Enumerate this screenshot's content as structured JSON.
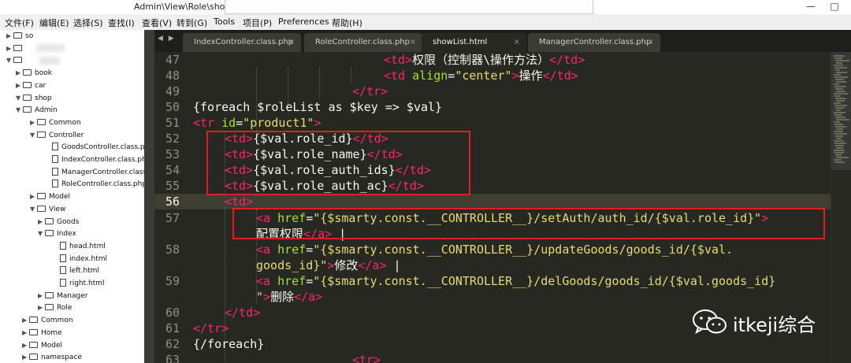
{
  "window": {
    "title_path": "Admin\\View\\Role\\showList.html",
    "title_suffix": "•",
    "controls": {
      "minimize": "—",
      "maximize": "□"
    }
  },
  "menu": [
    "文件(F)",
    "编辑(E)",
    "选择(S)",
    "查找(I)",
    "查看(V)",
    "转到(G)",
    "Tools",
    "项目(P)",
    "Preferences",
    "帮助(H)"
  ],
  "sidebar": {
    "items": [
      {
        "label": "so",
        "type": "folder",
        "state": "collapsed",
        "depth": 0
      },
      {
        "label": "",
        "type": "folder",
        "state": "collapsed",
        "depth": 0
      },
      {
        "label": "",
        "type": "folder",
        "state": "expanded",
        "depth": 0
      },
      {
        "label": "book",
        "type": "folder",
        "state": "collapsed",
        "depth": 1
      },
      {
        "label": "car",
        "type": "folder",
        "state": "collapsed",
        "depth": 1
      },
      {
        "label": "shop",
        "type": "folder",
        "state": "expanded",
        "depth": 1
      },
      {
        "label": "Admin",
        "type": "folder",
        "state": "expanded",
        "depth": 2
      },
      {
        "label": "Common",
        "type": "folder",
        "state": "collapsed",
        "depth": 3
      },
      {
        "label": "Controller",
        "type": "folder",
        "state": "expanded",
        "depth": 3
      },
      {
        "label": "GoodsController.class.ph",
        "type": "file",
        "depth": 4
      },
      {
        "label": "IndexController.class.ph",
        "type": "file",
        "depth": 4
      },
      {
        "label": "ManagerController.class",
        "type": "file",
        "depth": 4
      },
      {
        "label": "RoleController.class.php",
        "type": "file",
        "depth": 4
      },
      {
        "label": "Model",
        "type": "folder",
        "state": "collapsed",
        "depth": 3
      },
      {
        "label": "View",
        "type": "folder",
        "state": "expanded",
        "depth": 3
      },
      {
        "label": "Goods",
        "type": "folder",
        "state": "collapsed",
        "depth": 4
      },
      {
        "label": "Index",
        "type": "folder",
        "state": "expanded",
        "depth": 4
      },
      {
        "label": "head.html",
        "type": "file",
        "depth": 5
      },
      {
        "label": "index.html",
        "type": "file",
        "depth": 5
      },
      {
        "label": "left.html",
        "type": "file",
        "depth": 5
      },
      {
        "label": "right.html",
        "type": "file",
        "depth": 5
      },
      {
        "label": "Manager",
        "type": "folder",
        "state": "collapsed",
        "depth": 4
      },
      {
        "label": "Role",
        "type": "folder",
        "state": "collapsed",
        "depth": 4
      },
      {
        "label": "Common",
        "type": "folder",
        "state": "collapsed",
        "depth": 2
      },
      {
        "label": "Home",
        "type": "folder",
        "state": "collapsed",
        "depth": 2
      },
      {
        "label": "Model",
        "type": "folder",
        "state": "collapsed",
        "depth": 2
      },
      {
        "label": "namespace",
        "type": "folder",
        "state": "collapsed",
        "depth": 2
      }
    ]
  },
  "tabs": {
    "nav": "◀ ▶",
    "close_glyph": "×",
    "items": [
      {
        "label": "IndexController.class.php",
        "active": false
      },
      {
        "label": "RoleController.class.php",
        "active": false
      },
      {
        "label": "showList.html",
        "active": true
      },
      {
        "label": "ManagerController.class.php",
        "active": false
      }
    ]
  },
  "editor": {
    "current_line": "56",
    "line_numbers": [
      "47",
      "48",
      "49",
      "50",
      "51",
      "52",
      "53",
      "54",
      "55",
      "56",
      "57",
      "",
      "58",
      "",
      "59",
      "",
      "60",
      "61",
      "62",
      "63"
    ],
    "colors": {
      "background": "#272822",
      "tag": "#f92672",
      "attribute": "#a6e22e",
      "string": "#e6db74",
      "text": "#f8f8f2",
      "annotation_box": "#e02020"
    },
    "lines": [
      [
        {
          "c": "t",
          "v": "<td>"
        },
        {
          "c": "k",
          "v": "权限（控制器\\操作方法）"
        },
        {
          "c": "t",
          "v": "</td>"
        }
      ],
      [
        {
          "c": "t",
          "v": "<td"
        },
        {
          "c": "k",
          "v": " "
        },
        {
          "c": "a",
          "v": "align"
        },
        {
          "c": "k",
          "v": "="
        },
        {
          "c": "s",
          "v": "\"center\""
        },
        {
          "c": "t",
          "v": ">"
        },
        {
          "c": "k",
          "v": "操作"
        },
        {
          "c": "t",
          "v": "</td>"
        }
      ],
      [
        {
          "c": "t",
          "v": "</tr>"
        }
      ],
      [
        {
          "c": "k",
          "v": "{foreach $roleList as $key => $val}"
        }
      ],
      [
        {
          "c": "t",
          "v": "<tr"
        },
        {
          "c": "k",
          "v": " "
        },
        {
          "c": "a",
          "v": "id"
        },
        {
          "c": "k",
          "v": "="
        },
        {
          "c": "s",
          "v": "\"product1\""
        },
        {
          "c": "t",
          "v": ">"
        }
      ],
      [
        {
          "c": "t",
          "v": "<td>"
        },
        {
          "c": "k",
          "v": "{$val.role_id}"
        },
        {
          "c": "t",
          "v": "</td>"
        }
      ],
      [
        {
          "c": "t",
          "v": "<td>"
        },
        {
          "c": "k",
          "v": "{$val.role_name}"
        },
        {
          "c": "t",
          "v": "</td>"
        }
      ],
      [
        {
          "c": "t",
          "v": "<td>"
        },
        {
          "c": "k",
          "v": "{$val.role_auth_ids}"
        },
        {
          "c": "t",
          "v": "</td>"
        }
      ],
      [
        {
          "c": "t",
          "v": "<td>"
        },
        {
          "c": "k",
          "v": "{$val.role_auth_ac}"
        },
        {
          "c": "t",
          "v": "</td>"
        }
      ],
      [
        {
          "c": "t",
          "v": "<td>"
        }
      ],
      [
        {
          "c": "t",
          "v": "<a"
        },
        {
          "c": "k",
          "v": " "
        },
        {
          "c": "a",
          "v": "href"
        },
        {
          "c": "k",
          "v": "="
        },
        {
          "c": "s",
          "v": "\"{$smarty.const.__CONTROLLER__}/setAuth/auth_id/{$val.role_id}\""
        },
        {
          "c": "t",
          "v": ">"
        }
      ],
      [
        {
          "c": "k",
          "v": "配置权限"
        },
        {
          "c": "t",
          "v": "</a>"
        },
        {
          "c": "k",
          "v": " |"
        }
      ],
      [
        {
          "c": "t",
          "v": "<a"
        },
        {
          "c": "k",
          "v": " "
        },
        {
          "c": "a",
          "v": "href"
        },
        {
          "c": "k",
          "v": "="
        },
        {
          "c": "s",
          "v": "\"{$smarty.const.__CONTROLLER__}/updateGoods/goods_id/{$val."
        }
      ],
      [
        {
          "c": "s",
          "v": "goods_id}\""
        },
        {
          "c": "t",
          "v": ">"
        },
        {
          "c": "k",
          "v": "修改"
        },
        {
          "c": "t",
          "v": "</a>"
        },
        {
          "c": "k",
          "v": " |"
        }
      ],
      [
        {
          "c": "t",
          "v": "<a"
        },
        {
          "c": "k",
          "v": " "
        },
        {
          "c": "a",
          "v": "href"
        },
        {
          "c": "k",
          "v": "="
        },
        {
          "c": "s",
          "v": "\"{$smarty.const.__CONTROLLER__}/delGoods/goods_id/{$val.goods_id}"
        }
      ],
      [
        {
          "c": "s",
          "v": "\""
        },
        {
          "c": "t",
          "v": ">"
        },
        {
          "c": "k",
          "v": "删除"
        },
        {
          "c": "t",
          "v": "</a>"
        }
      ],
      [
        {
          "c": "t",
          "v": "</td>"
        }
      ],
      [
        {
          "c": "t",
          "v": "</tr>"
        }
      ],
      [
        {
          "c": "k",
          "v": "{/foreach}"
        }
      ],
      [
        {
          "c": "t",
          "v": "<tr>"
        }
      ]
    ]
  },
  "watermark": {
    "text": "itkeji综合",
    "icon": "wechat-icon"
  }
}
